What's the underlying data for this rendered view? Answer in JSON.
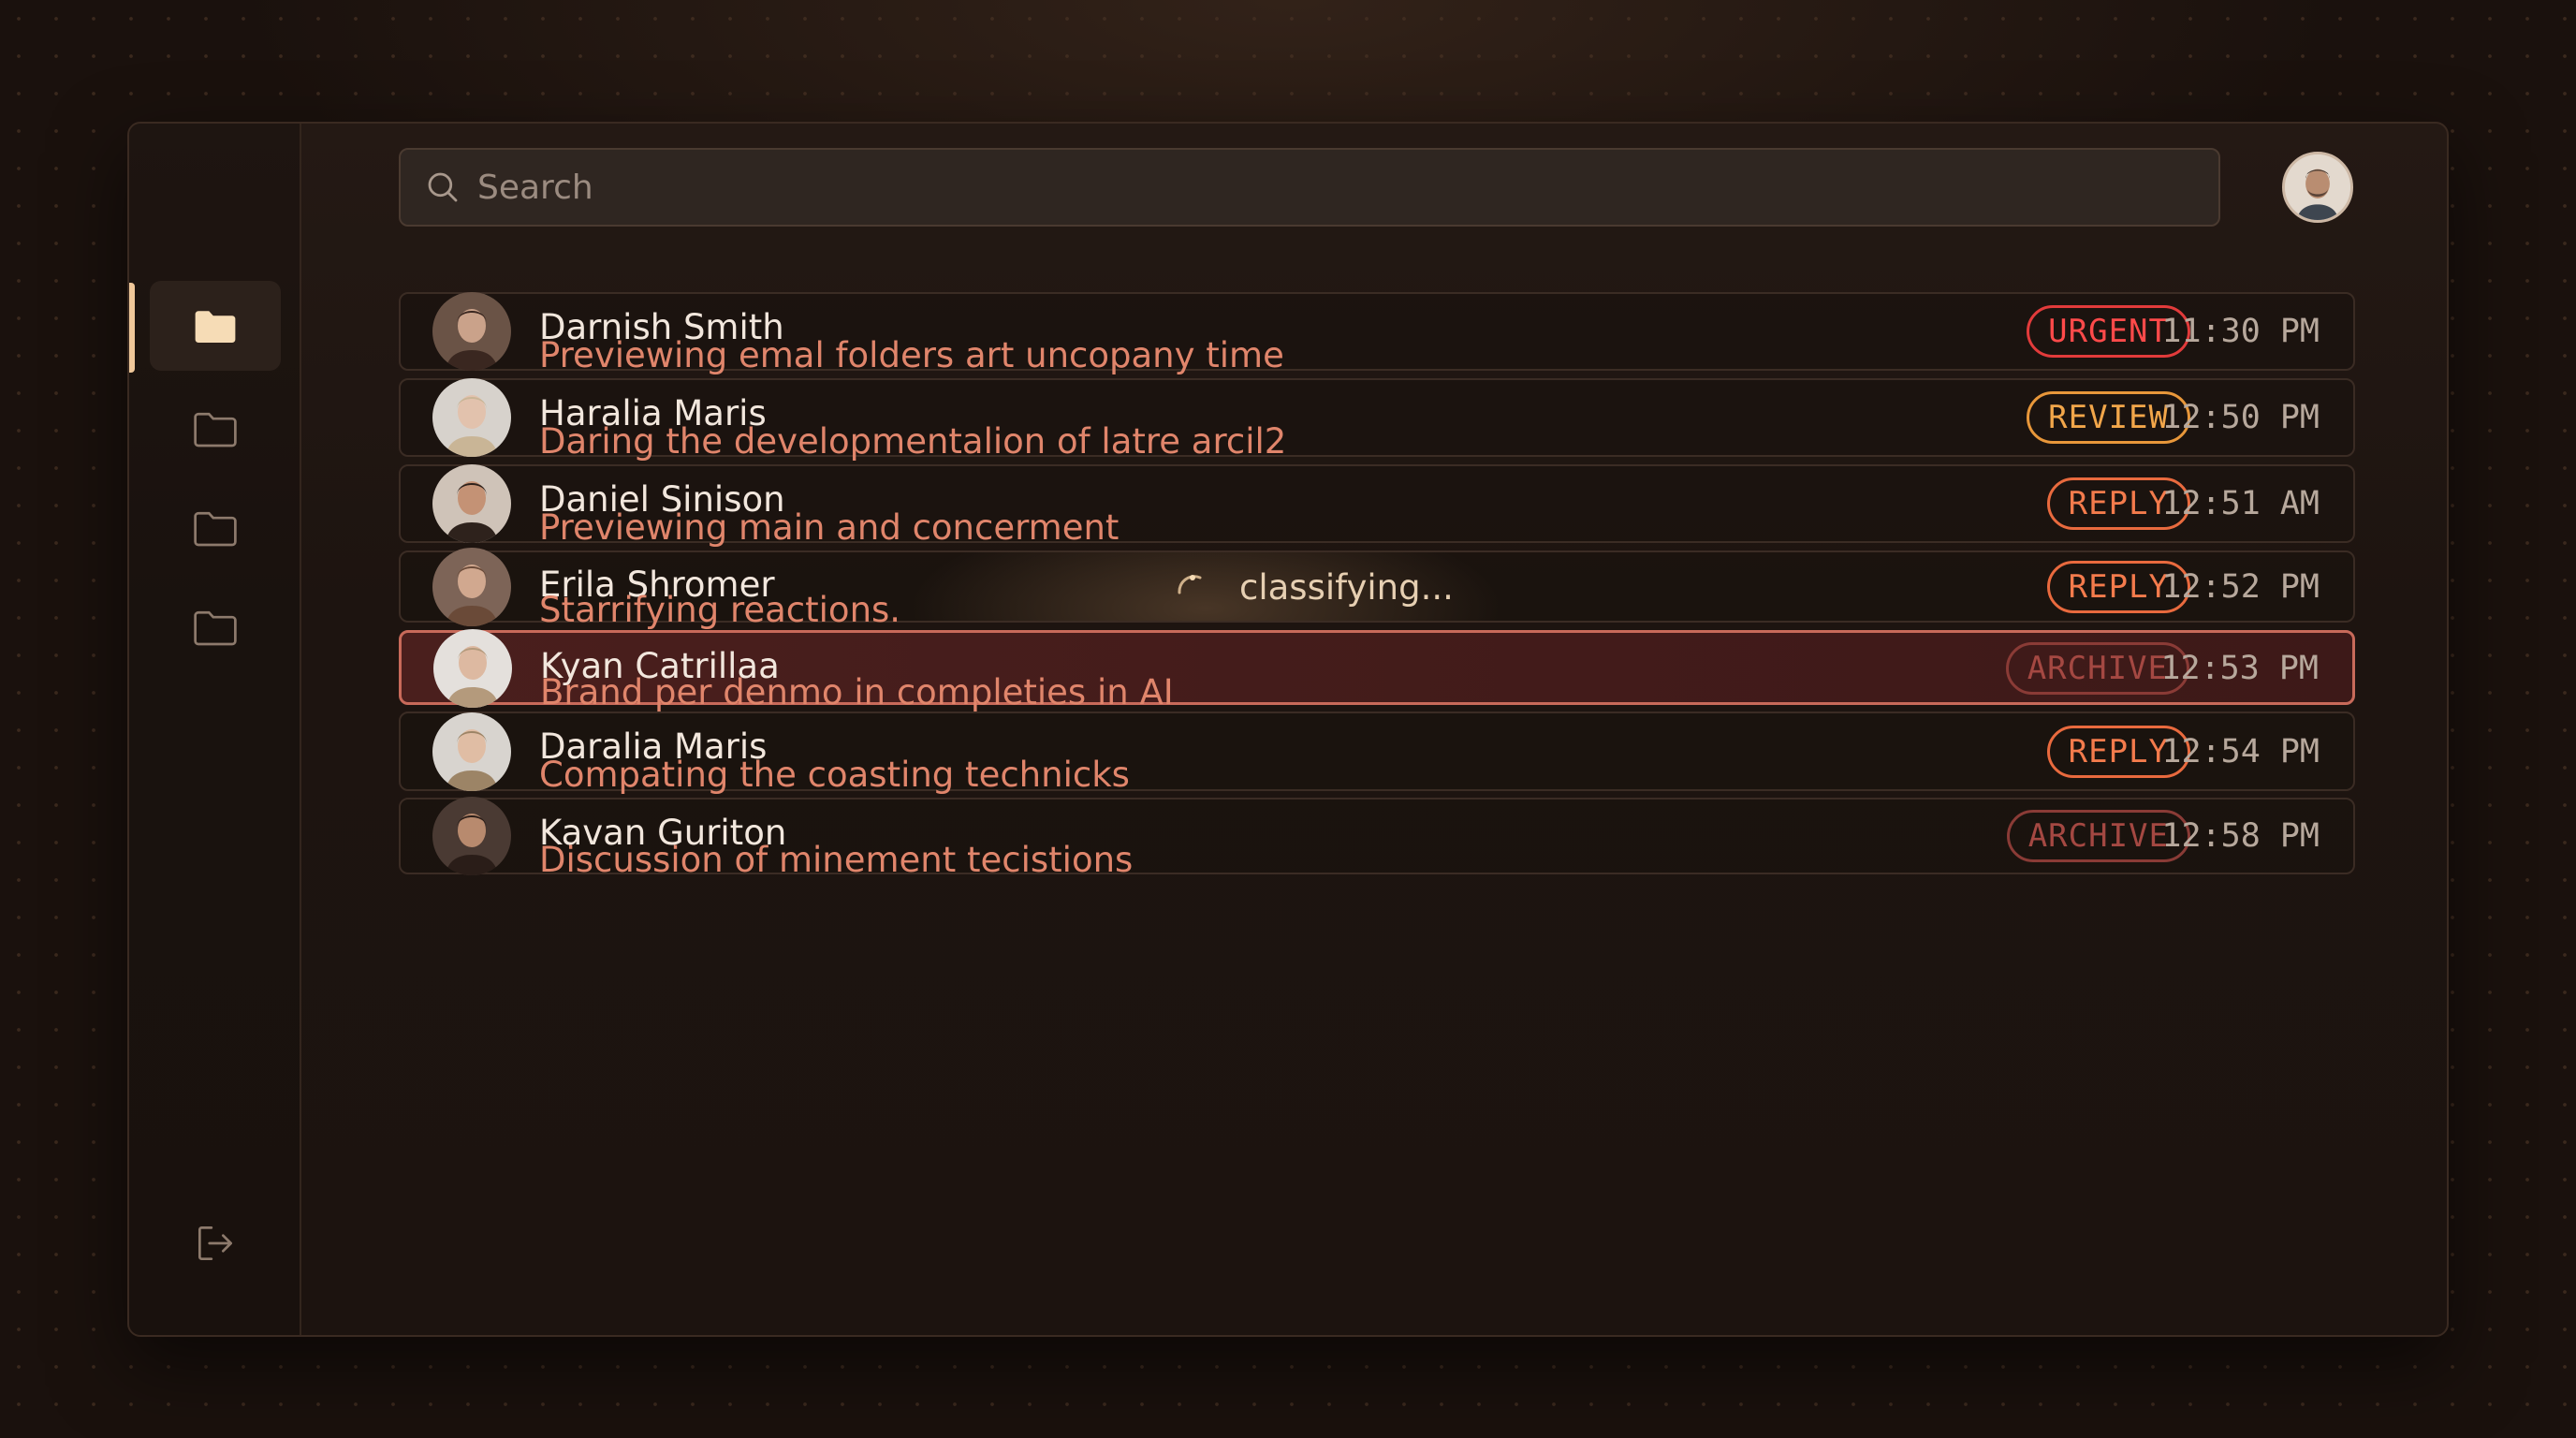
{
  "search": {
    "placeholder": "Search"
  },
  "sidebar": {
    "items": [
      {
        "icon": "folder-filled-icon",
        "active": true
      },
      {
        "icon": "folder-icon",
        "active": false
      },
      {
        "icon": "folder-icon",
        "active": false
      },
      {
        "icon": "folder-icon",
        "active": false
      }
    ],
    "logout_icon": "logout-icon"
  },
  "colors": {
    "accent": "#f0c89a",
    "urgent": "#ff4a4a",
    "review": "#f2a64a",
    "reply": "#f47b4c",
    "archive": "#a44842",
    "preview_text": "#e0856b"
  },
  "emails": [
    {
      "name": "Darnish Smith",
      "preview": "Previewing emal folders art uncopany time",
      "tag": "URGENT",
      "time": "11:30 PM"
    },
    {
      "name": "Haralia Maris",
      "preview": "Daring the developmentalion of latre arcil2",
      "tag": "REVIEW",
      "time": "12:50 PM"
    },
    {
      "name": "Daniel Sinison",
      "preview": "Previewing main and concerment",
      "tag": "REPLY",
      "time": "12:51 AM"
    },
    {
      "name": "Erila Shromer",
      "preview": "Starrifying reactions.",
      "tag": "REPLY",
      "time": "12:52 PM",
      "status": "classifying..."
    },
    {
      "name": "Kyan Catrillaa",
      "preview": "Brand per denmo in completies in AI",
      "tag": "ARCHIVE",
      "time": "12:53 PM",
      "selected": true
    },
    {
      "name": "Daralia Maris",
      "preview": "Compating the coasting technicks",
      "tag": "REPLY",
      "time": "12:54 PM"
    },
    {
      "name": "Kavan Guriton",
      "preview": "Discussion of minement tecistions",
      "tag": "ARCHIVE",
      "time": "12:58 PM"
    }
  ]
}
